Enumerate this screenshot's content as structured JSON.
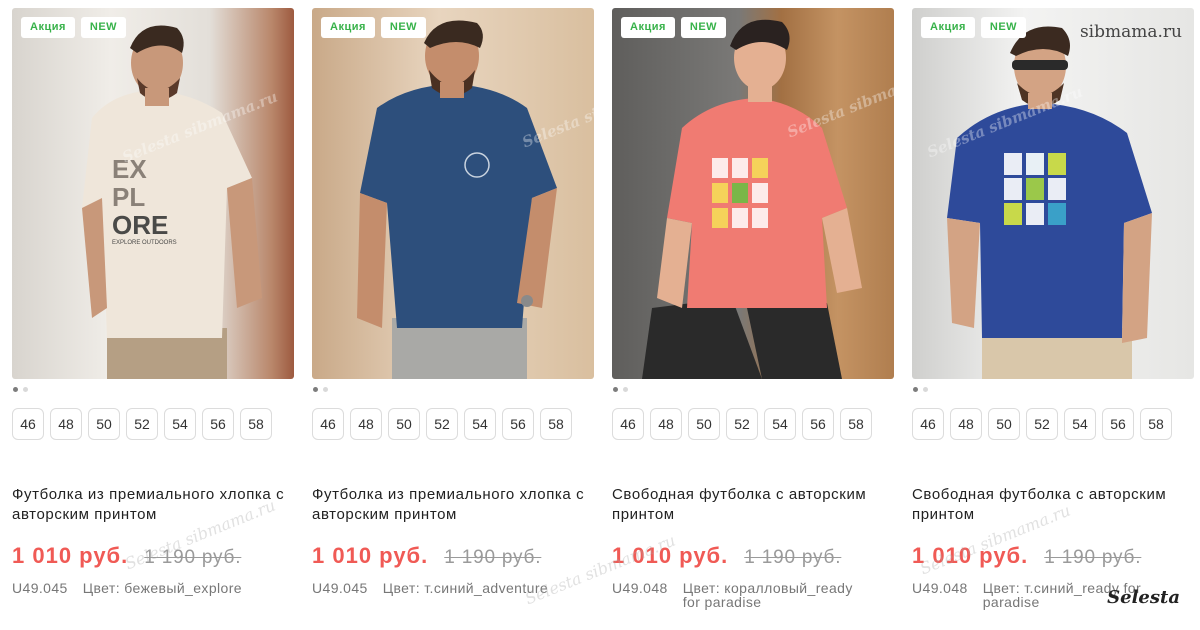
{
  "watermarks": {
    "site": "sibmama.ru",
    "brand": "Selesta",
    "diagonal": "Selesta sibmama.ru"
  },
  "products": [
    {
      "badges": [
        "Акция",
        "NEW"
      ],
      "sizes": [
        "46",
        "48",
        "50",
        "52",
        "54",
        "56",
        "58"
      ],
      "title": "Футболка из премиального хлопка с авторским принтом",
      "price_new": "1 010 руб.",
      "price_old": "1 190 руб.",
      "sku": "U49.045",
      "color": "Цвет: бежевый_explore",
      "photo": {
        "bg": "#e7e3dd",
        "shirt": "#efe6da",
        "pants": "#b59f84",
        "print": "EX PL ORE",
        "print_sub": "EXPLORE OUTDOORS"
      }
    },
    {
      "badges": [
        "Акция",
        "NEW"
      ],
      "sizes": [
        "46",
        "48",
        "50",
        "52",
        "54",
        "56",
        "58"
      ],
      "title": "Футболка из премиального хлопка с авторским принтом",
      "price_new": "1 010 руб.",
      "price_old": "1 190 руб.",
      "sku": "U49.045",
      "color": "Цвет: т.синий_adventure",
      "photo": {
        "bg": "#e4cdb0",
        "shirt": "#2d4f7c",
        "pants": "#a9a9a6"
      }
    },
    {
      "badges": [
        "Акция",
        "NEW"
      ],
      "sizes": [
        "46",
        "48",
        "50",
        "52",
        "54",
        "56",
        "58"
      ],
      "title": "Свободная футболка с авторским принтом",
      "price_new": "1 010 руб.",
      "price_old": "1 190 руб.",
      "sku": "U49.048",
      "color": "Цвет: коралловый_ready for paradise",
      "photo": {
        "bg": "#6f6e6c",
        "shirt": "#f07b72",
        "pants": "#2a2a2a"
      }
    },
    {
      "badges": [
        "Акция",
        "NEW"
      ],
      "sizes": [
        "46",
        "48",
        "50",
        "52",
        "54",
        "56",
        "58"
      ],
      "title": "Свободная футболка с авторским принтом",
      "price_new": "1 010 руб.",
      "price_old": "1 190 руб.",
      "sku": "U49.048",
      "color": "Цвет: т.синий_ready for paradise",
      "photo": {
        "bg": "#ebebea",
        "shirt": "#2e4a9a",
        "pants": "#d9c7aa"
      }
    }
  ]
}
